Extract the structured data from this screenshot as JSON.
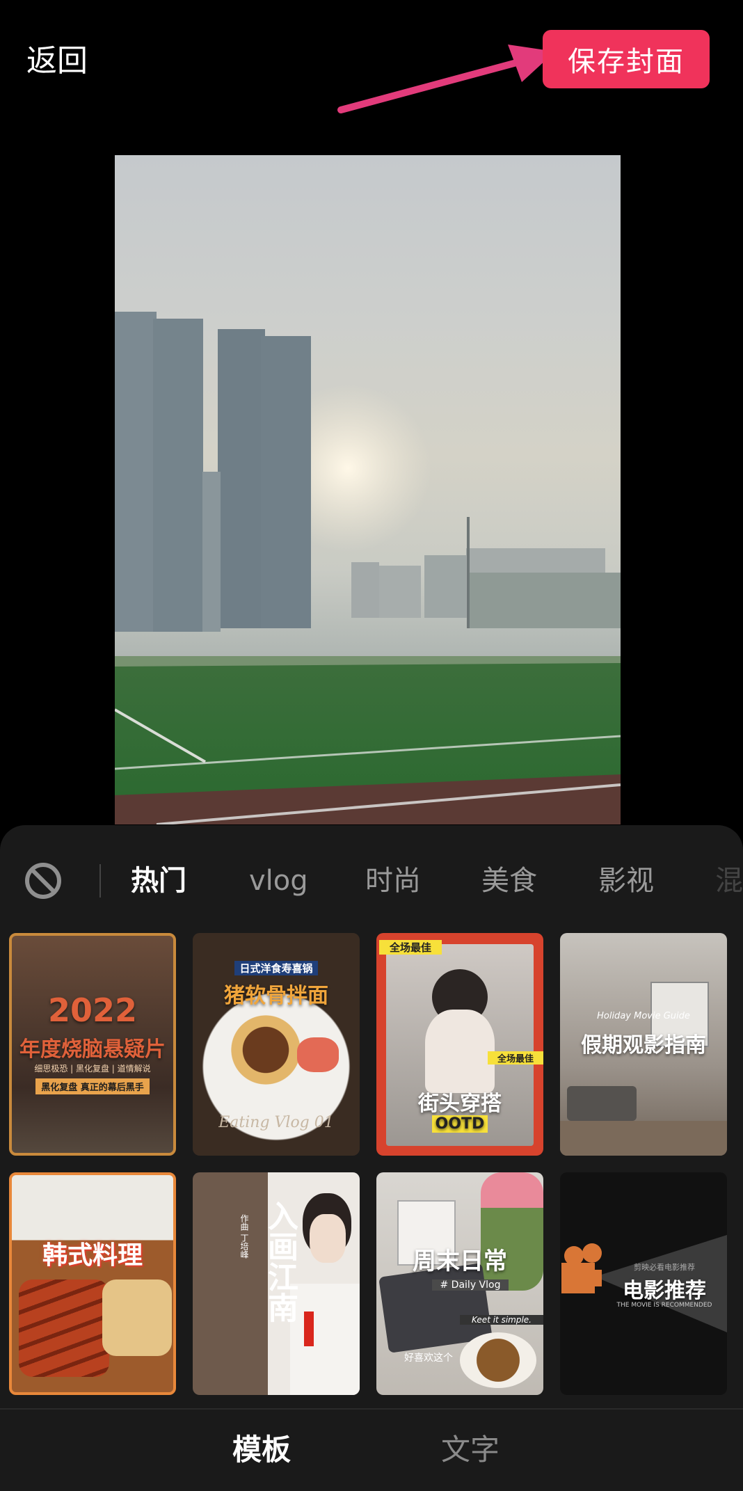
{
  "header": {
    "back_label": "返回",
    "save_label": "保存封面"
  },
  "category_tabs": [
    "热门",
    "vlog",
    "时尚",
    "美食",
    "影视",
    "混"
  ],
  "templates": [
    {
      "title": "2022",
      "subtitle": "年度烧脑悬疑片",
      "tags": "细思极恐 | 黑化复盘 | 道情解说",
      "footer": "黑化复盘 真正的幕后黑手"
    },
    {
      "title": "猪软骨拌面",
      "subtitle": "日式洋食寿喜锅",
      "footer": "Eating Vlog 01"
    },
    {
      "title": "街头穿搭",
      "subtitle": "OOTD",
      "badge1": "全场最佳",
      "badge2": "全场最佳"
    },
    {
      "title": "假期观影指南",
      "subtitle": "Holiday Movie Guide"
    },
    {
      "title": "韩式料理"
    },
    {
      "title": "入画江南",
      "subtitle": "作曲 丁培峰"
    },
    {
      "title": "周末日常",
      "subtitle": "# Daily Vlog",
      "footer": "Keet it simple.",
      "footer2": "好喜欢这个"
    },
    {
      "title": "电影推荐",
      "subtitle": "THE MOVIE IS RECOMMENDED",
      "small": "剪映必看电影推荐"
    }
  ],
  "bottom_tabs": {
    "left": "模板",
    "right": "文字"
  },
  "colors": {
    "accent": "#f0335b",
    "panel": "#1a1a1a"
  },
  "icons": [
    "no-symbol-icon",
    "arrow-annotation-icon"
  ]
}
